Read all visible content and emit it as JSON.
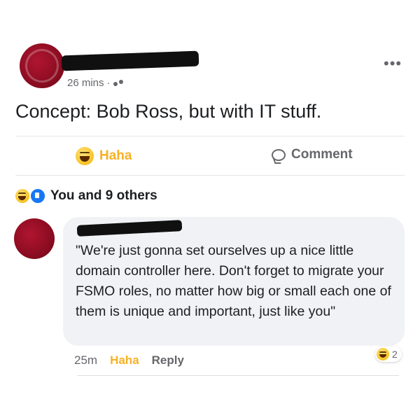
{
  "post": {
    "time": "26 mins",
    "separator": "·",
    "more_label": "•••",
    "text": "Concept: Bob Ross, but with IT stuff."
  },
  "actions": {
    "haha_label": "Haha",
    "comment_label": "Comment"
  },
  "reactions_summary": {
    "text": "You and 9 others"
  },
  "comment": {
    "text": "\"We're just gonna set ourselves up a nice little domain controller here. Don't forget to migrate your FSMO roles, no matter how big or small each one of them is unique and important, just like you\"",
    "time": "25m",
    "haha_label": "Haha",
    "reply_label": "Reply",
    "reaction_count": "2"
  },
  "colors": {
    "haha": "#f7b125",
    "like": "#1877f2",
    "meta": "#65676b",
    "bubble": "#f0f2f5"
  }
}
